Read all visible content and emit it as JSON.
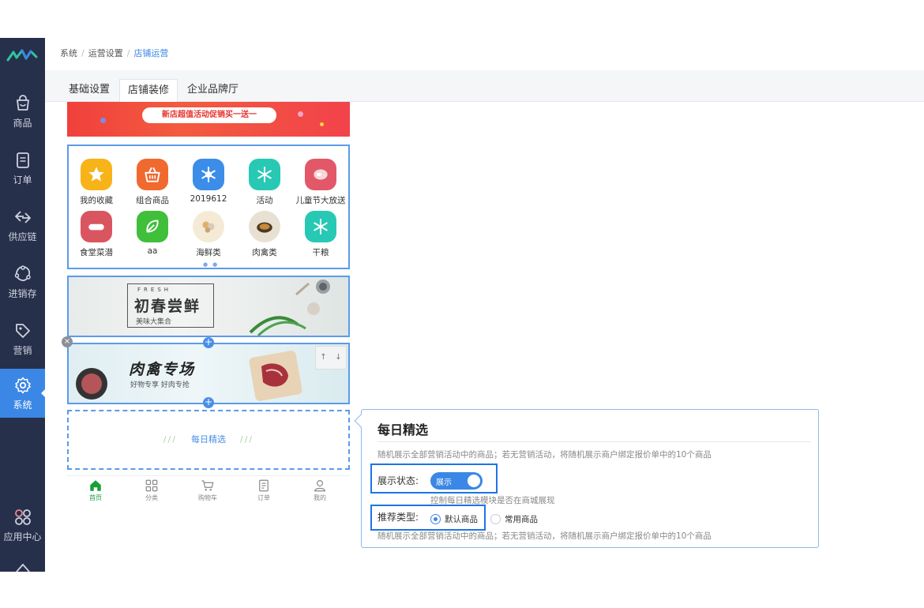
{
  "breadcrumb": {
    "items": [
      "系统",
      "运营设置"
    ],
    "current": "店铺运营"
  },
  "tabs": [
    {
      "label": "基础设置"
    },
    {
      "label": "店铺装修"
    },
    {
      "label": "企业品牌厅"
    }
  ],
  "sidebar": {
    "items": [
      {
        "label": "商品",
        "icon": "shopping-bag-icon"
      },
      {
        "label": "订单",
        "icon": "document-icon"
      },
      {
        "label": "供应链",
        "icon": "exchange-arrows-icon"
      },
      {
        "label": "进销存",
        "icon": "inventory-icon"
      },
      {
        "label": "营销",
        "icon": "tag-icon"
      },
      {
        "label": "系统",
        "icon": "gear-icon"
      },
      {
        "label": "应用中心",
        "icon": "apps-icon"
      }
    ],
    "active": "系统",
    "colors": {
      "bg": "#27304a",
      "active": "#3b87e6"
    }
  },
  "preview": {
    "top_banner": {
      "text": "新店超值活动促销买一送一"
    },
    "shortcut_icons": [
      {
        "label": "我的收藏",
        "icon": "star-icon",
        "color": "#f7b318"
      },
      {
        "label": "组合商品",
        "icon": "basket-icon",
        "color": "#f06a2f"
      },
      {
        "label": "2019612",
        "icon": "snowflake-icon",
        "color": "#3c8de8"
      },
      {
        "label": "活动",
        "icon": "snowflake-icon",
        "color": "#27c9b4"
      },
      {
        "label": "儿童节大放送",
        "icon": "meat-icon",
        "color": "#e25868"
      },
      {
        "label": "食堂菜潜",
        "icon": "sausage-icon",
        "color": "#d9555f"
      },
      {
        "label": "aa",
        "icon": "leaf-icon",
        "color": "#3fbf3a"
      },
      {
        "label": "海鲜类",
        "icon": "seafood-icon",
        "color": "#e9c88f"
      },
      {
        "label": "肉禽类",
        "icon": "dish-icon",
        "color": "#8a6a3a"
      },
      {
        "label": "干粮",
        "icon": "snowflake-icon",
        "color": "#27c9b4"
      }
    ],
    "fresh_banner": {
      "en": "FRESH",
      "title": "初春尝鲜",
      "subtitle": "美味大集合"
    },
    "meat_banner": {
      "title": "肉禽专场",
      "subtitle": "好物专享 好肉专抢"
    },
    "move_controls": {
      "up": "↑",
      "down": "↓"
    },
    "daily_module": {
      "slashes_left": "///",
      "label": "每日精选",
      "slashes_right": "///"
    },
    "bottom_nav": [
      {
        "label": "首页",
        "icon": "home-icon"
      },
      {
        "label": "分类",
        "icon": "category-grid-icon"
      },
      {
        "label": "购物车",
        "icon": "cart-icon"
      },
      {
        "label": "订单",
        "icon": "order-list-icon"
      },
      {
        "label": "我的",
        "icon": "user-icon"
      }
    ]
  },
  "panel": {
    "title": "每日精选",
    "description": "随机展示全部营销活动中的商品；若无营销活动，将随机展示商户绑定报价单中的10个商品",
    "display_status": {
      "label": "展示状态:",
      "switch_text": "展示",
      "enabled": true,
      "hint": "控制每日精选模块是否在商城展现"
    },
    "recommend_type": {
      "label": "推荐类型:",
      "options": [
        {
          "label": "默认商品",
          "checked": true
        },
        {
          "label": "常用商品",
          "checked": false
        }
      ],
      "description": "随机展示全部营销活动中的商品；若无营销活动，将随机展示商户绑定报价单中的10个商品"
    }
  }
}
